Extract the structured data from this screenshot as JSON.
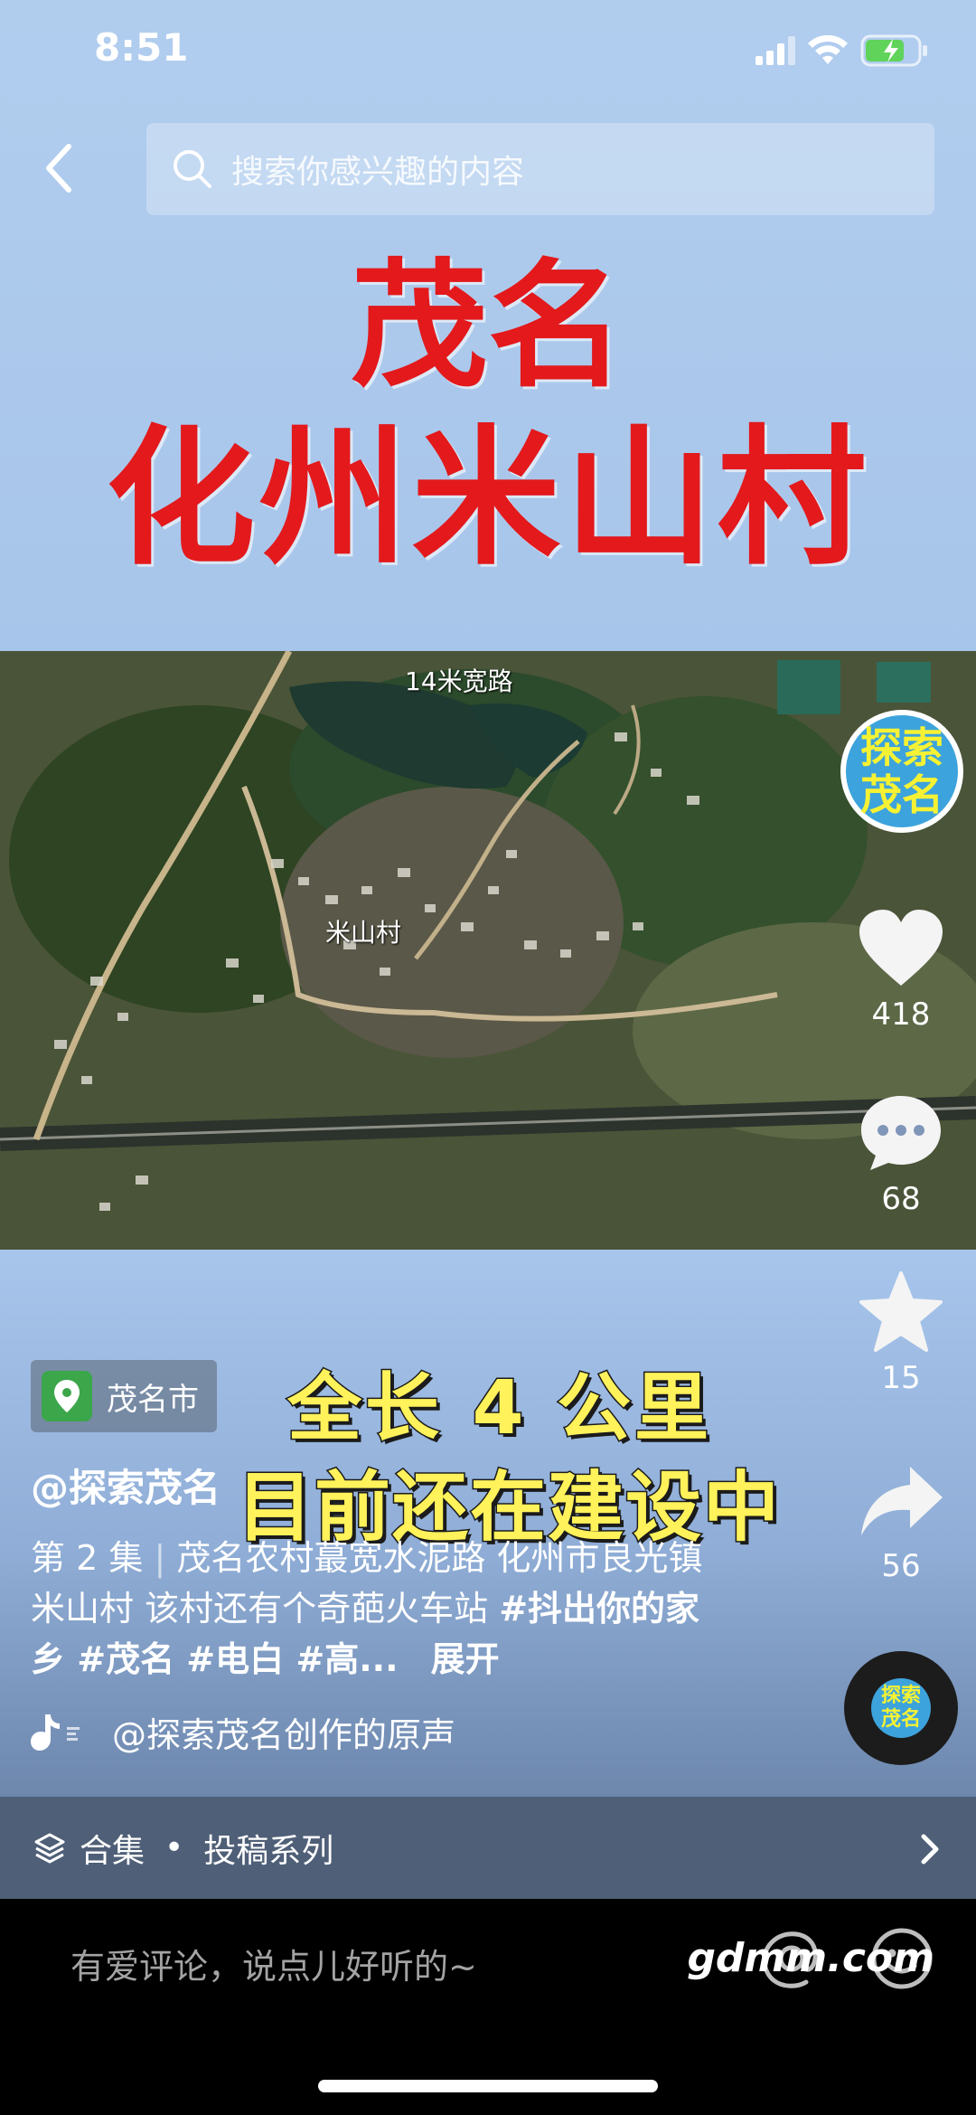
{
  "status_bar": {
    "time": "8:51"
  },
  "search": {
    "placeholder": "搜索你感兴趣的内容"
  },
  "title": {
    "line1": "茂名",
    "line2": "化州米山村"
  },
  "map": {
    "road_label": "14米宽路",
    "village_label": "米山村"
  },
  "avatar": {
    "text1": "探索",
    "text2": "茂名"
  },
  "actions": {
    "likes": "418",
    "comments": "68",
    "favorites": "15",
    "shares": "56"
  },
  "location": {
    "label": "茂名市"
  },
  "subtitles": {
    "line1": "全长 4 公里",
    "line2": "目前还在建设中"
  },
  "author": {
    "name": "@探索茂名"
  },
  "description": {
    "episode": "第 2 集",
    "divider": "|",
    "text": "茂名农村蕞宽水泥路 化州市良光镇米山村 该村还有个奇葩火车站",
    "hashtags": "#抖出你的家乡 #茂名 #电白 #高...",
    "expand": "展开"
  },
  "music": {
    "text": "@探索茂名创作的原声"
  },
  "disc": {
    "text1": "探索",
    "text2": "茂名"
  },
  "collection": {
    "label": "合集",
    "separator": "•",
    "series": "投稿系列"
  },
  "comment": {
    "placeholder": "有爱评论，说点儿好听的~"
  },
  "watermark": "gdmm.com"
}
